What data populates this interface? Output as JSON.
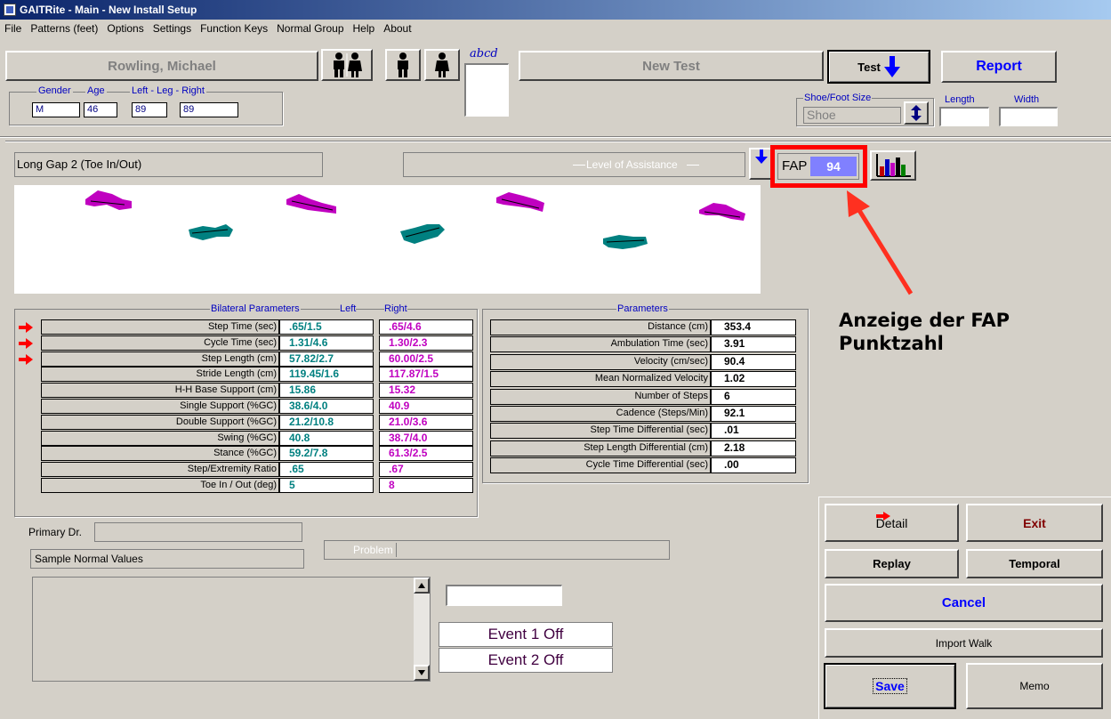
{
  "window": {
    "title": "GAITRite  - Main - New Install Setup"
  },
  "menu": [
    "File",
    "Patterns (feet)",
    "Options",
    "Settings",
    "Function Keys",
    "Normal Group",
    "Help",
    "About"
  ],
  "patient": {
    "name": "Rowling, Michael",
    "gender_label": "Gender",
    "age_label": "Age",
    "leg_label": "Left - Leg - Right",
    "gender": "M",
    "age": "46",
    "leg_left": "89",
    "leg_right": "89"
  },
  "signature_label": "abcd",
  "new_test_label": "New Test",
  "test_label": "Test",
  "report_label": "Report",
  "shoe": {
    "group_label": "Shoe/Foot Size",
    "value": "Shoe",
    "length_label": "Length",
    "width_label": "Width"
  },
  "test_name": "Long Gap 2 (Toe In/Out)",
  "assistance_label": "Level of Assistance",
  "fap": {
    "label": "FAP",
    "value": "94"
  },
  "annotation": {
    "line1": "Anzeige der FAP",
    "line2": "Punktzahl"
  },
  "bilateral": {
    "title": "Bilateral  Parameters",
    "left_header": "Left",
    "right_header": "Right",
    "rows": [
      {
        "label": "Step Time (sec)",
        "left": ".65/1.5",
        "right": ".65/4.6",
        "flag": true
      },
      {
        "label": "Cycle Time (sec)",
        "left": "1.31/4.6",
        "right": "1.30/2.3",
        "flag": true
      },
      {
        "label": "Step Length (cm)",
        "left": "57.82/2.7",
        "right": "60.00/2.5",
        "flag": true
      },
      {
        "label": "Stride Length (cm)",
        "left": "119.45/1.6",
        "right": "117.87/1.5",
        "flag": false
      },
      {
        "label": "H-H Base Support (cm)",
        "left": "15.86",
        "right": "15.32",
        "flag": false
      },
      {
        "label": "Single Support (%GC)",
        "left": "38.6/4.0",
        "right": "40.9",
        "flag": false
      },
      {
        "label": "Double Support (%GC)",
        "left": "21.2/10.8",
        "right": "21.0/3.6",
        "flag": false
      },
      {
        "label": "Swing (%GC)",
        "left": "40.8",
        "right": "38.7/4.0",
        "flag": false
      },
      {
        "label": "Stance (%GC)",
        "left": "59.2/7.8",
        "right": "61.3/2.5",
        "flag": false
      },
      {
        "label": "Step/Extremity Ratio",
        "left": ".65",
        "right": ".67",
        "flag": false
      },
      {
        "label": "Toe In / Out (deg)",
        "left": "5",
        "right": "8",
        "flag": false
      }
    ]
  },
  "parameters": {
    "title": "Parameters",
    "rows": [
      {
        "label": "Distance (cm)",
        "value": "353.4"
      },
      {
        "label": "Ambulation Time (sec)",
        "value": "3.91"
      },
      {
        "label": "Velocity (cm/sec)",
        "value": "90.4"
      },
      {
        "label": "Mean Normalized Velocity",
        "value": "1.02"
      },
      {
        "label": "Number of Steps",
        "value": "6"
      },
      {
        "label": "Cadence (Steps/Min)",
        "value": "92.1"
      },
      {
        "label": "Step Time Differential (sec)",
        "value": ".01"
      },
      {
        "label": "Step Length Differential (cm)",
        "value": "2.18"
      },
      {
        "label": "Cycle Time Differential (sec)",
        "value": ".00"
      }
    ]
  },
  "primary_dr_label": "Primary Dr.",
  "problem_label": "Problem",
  "normal_values": "Sample Normal Values",
  "events": {
    "event1": "Event 1 Off",
    "event2": "Event 2 Off"
  },
  "buttons": {
    "detail": "Detail",
    "exit": "Exit",
    "replay": "Replay",
    "temporal": "Temporal",
    "cancel": "Cancel",
    "import_walk": "Import Walk",
    "save": "Save",
    "memo": "Memo"
  },
  "colors": {
    "left_foot": "#008080",
    "right_foot": "#c000c0",
    "highlight": "#ff0000",
    "fap_value_bg": "#8080ff"
  }
}
